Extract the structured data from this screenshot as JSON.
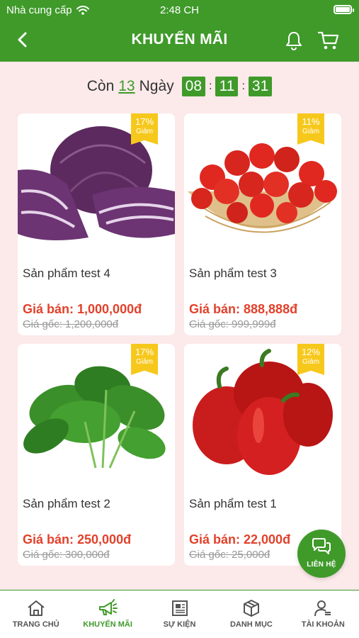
{
  "status_bar": {
    "carrier": "Nhà cung cấp",
    "time": "2:48 CH"
  },
  "header": {
    "title": "KHUYẾN MÃI"
  },
  "countdown": {
    "prefix": "Còn",
    "days": "13",
    "days_label": "Ngày",
    "hours": "08",
    "minutes": "11",
    "seconds": "31"
  },
  "products": [
    {
      "name": "Sản phẩm test 4",
      "price": "Giá bán: 1,000,000đ",
      "original": "Giá gốc: 1,200,000đ",
      "discount": "17%",
      "discount_label": "Giảm",
      "image": "red-cabbage"
    },
    {
      "name": "Sản phẩm test 3",
      "price": "Giá bán: 888,888đ",
      "original": "Giá gốc: 999,999đ",
      "discount": "11%",
      "discount_label": "Giảm",
      "image": "cherry-tomatoes"
    },
    {
      "name": "Sản phẩm test 2",
      "price": "Giá bán: 250,000đ",
      "original": "Giá gốc: 300,000đ",
      "discount": "17%",
      "discount_label": "Giảm",
      "image": "spinach"
    },
    {
      "name": "Sản phẩm test 1",
      "price": "Giá bán: 22,000đ",
      "original": "Giá gốc: 25,000đ",
      "discount": "12%",
      "discount_label": "Giảm",
      "image": "red-bell-peppers"
    }
  ],
  "contact_button": {
    "label": "LIÊN HỆ"
  },
  "tabs": [
    {
      "label": "TRANG CHỦ",
      "icon": "home-icon"
    },
    {
      "label": "KHUYẾN MÃI",
      "icon": "megaphone-icon",
      "active": true
    },
    {
      "label": "SỰ KIỆN",
      "icon": "newspaper-icon"
    },
    {
      "label": "DANH MỤC",
      "icon": "box-icon"
    },
    {
      "label": "TÀI KHOẢN",
      "icon": "user-icon"
    }
  ],
  "colors": {
    "primary": "#3f9a2a",
    "background": "#fce9ea",
    "price": "#e2412b",
    "badge": "#f7c81c"
  }
}
